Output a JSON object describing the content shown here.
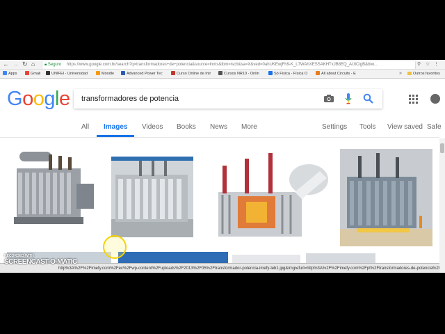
{
  "browser": {
    "secure_label": "Seguro",
    "url": "https://www.google.com.br/search?q=transformadores+de+potencia&source=lnms&tbm=isch&sa=X&ved=0ahUKEwjFh9-K_L7WAhXESSAKHTxJB8EQ_AUICigB&biw...",
    "bookmarks": [
      {
        "label": "Apps",
        "color": "#4285f4"
      },
      {
        "label": "Gmail",
        "color": "#ea4335"
      },
      {
        "label": "UNIFEI - Universidad",
        "color": "#333333"
      },
      {
        "label": "Moodle",
        "color": "#f39c12"
      },
      {
        "label": "Advanced Power Tec",
        "color": "#2a5db0"
      },
      {
        "label": "Curso Online de Intr",
        "color": "#c0392b"
      },
      {
        "label": "Cursos NR10 - Onlin",
        "color": "#555555"
      },
      {
        "label": "Só Física - Física O",
        "color": "#1a73e8"
      },
      {
        "label": "All about Circuits - E",
        "color": "#e67e22"
      }
    ],
    "bookmarks_more": "»",
    "other_bookmarks": "Outros favoritos"
  },
  "search": {
    "query": "transformadores de potencia"
  },
  "logo": {
    "letters": [
      {
        "char": "G",
        "color": "#4285f4"
      },
      {
        "char": "o",
        "color": "#ea4335"
      },
      {
        "char": "o",
        "color": "#fbbc05"
      },
      {
        "char": "g",
        "color": "#4285f4"
      },
      {
        "char": "l",
        "color": "#34a853"
      },
      {
        "char": "e",
        "color": "#ea4335"
      }
    ]
  },
  "tabs": {
    "all": "All",
    "images": "Images",
    "videos": "Videos",
    "books": "Books",
    "news": "News",
    "more": "More",
    "settings": "Settings",
    "tools": "Tools",
    "view_saved": "View saved",
    "safe": "Safe"
  },
  "status_bar": {
    "text": "http%3A%2F%2Fimefy.com%2Fec%2Fwp-content%2Fuploads%2F2013%2F05%2Ftransformador-potencia-imefy-leb1.jpg&imgrefurl=http%3A%2F%2Fimefy.com%2Fpt%2Ftransformadores-de-potencia%2F&..."
  },
  "watermark": {
    "line1": "RECORDED WITH",
    "line2": "SCREENCAST-O-MATIC"
  },
  "colors": {
    "accent": "#1a73e8",
    "secure": "#1e8e3e"
  }
}
